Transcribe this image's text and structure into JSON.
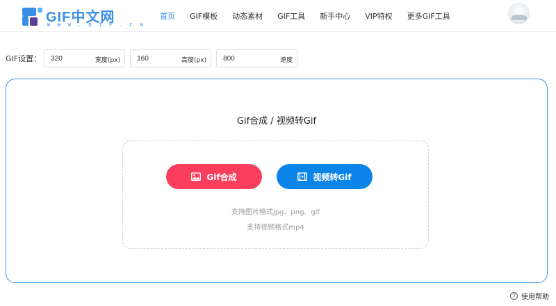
{
  "header": {
    "logo": {
      "text": "GIF中文网",
      "subtext": "W W W . G I F . C N"
    },
    "nav": [
      {
        "label": "首页",
        "active": true
      },
      {
        "label": "GIF模板"
      },
      {
        "label": "动态素材"
      },
      {
        "label": "GIF工具"
      },
      {
        "label": "新手中心"
      },
      {
        "label": "VIP特权"
      },
      {
        "label": "更多GIF工具"
      }
    ]
  },
  "settings": {
    "label": "GIF设置：",
    "width": {
      "value": "320",
      "unit": "宽度(px)"
    },
    "height": {
      "value": "160",
      "unit": "高度(px)"
    },
    "speed": {
      "value": "800",
      "unit": "速度"
    }
  },
  "panel": {
    "title": "Gif合成 / 视频转Gif",
    "gif_button": "Gif合成",
    "video_button": "视频转Gif",
    "hint_image": "支持图片格式jpg、png、gif",
    "hint_video": "支持视频格式mp4"
  },
  "help": {
    "label": "使用帮助"
  },
  "colors": {
    "accent": "#2f8df0",
    "gif_button": "#fb3e5d",
    "video_button": "#0a84e8",
    "panel_border": "#3d95ea"
  },
  "icons": {
    "gif_button": "image-icon",
    "video_button": "film-icon",
    "help": "question-circle-icon"
  }
}
